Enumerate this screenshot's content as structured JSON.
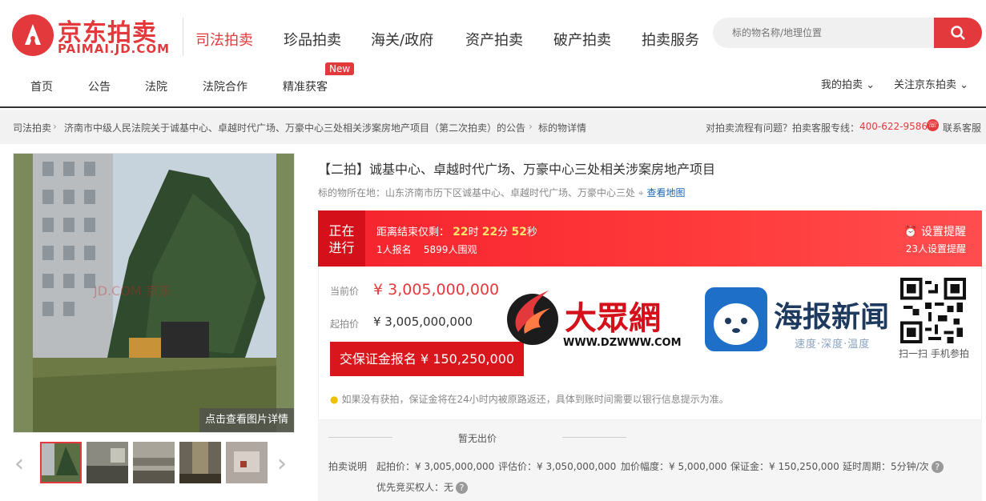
{
  "header": {
    "logo_cn": "京东拍卖",
    "logo_en": "PAIMAI.JD.COM",
    "categories": [
      "司法拍卖",
      "珍品拍卖",
      "海关/政府",
      "资产拍卖",
      "破产拍卖",
      "拍卖服务"
    ],
    "search_placeholder": "标的物名称/地理位置",
    "nav": [
      "首页",
      "公告",
      "法院",
      "法院合作",
      "精准获客"
    ],
    "new_tag": "New",
    "right_nav": [
      "我的拍卖",
      "关注京东拍卖"
    ],
    "accent_color": "#e4393c"
  },
  "breadcrumb": {
    "items": [
      "司法拍卖",
      "济南市中级人民法院关于诚基中心、卓越时代广场、万豪中心三处相关涉案房地产项目（第二次拍卖）的公告",
      "标的物详情"
    ],
    "help_text": "对拍卖流程有问题？拍卖客服专线：",
    "phone": "400-622-9586",
    "service": "联系客服"
  },
  "gallery": {
    "image_button": "点击查看图片详情",
    "watermark": "JD.COM 京东"
  },
  "item": {
    "title": "【二拍】诚基中心、卓越时代广场、万豪中心三处相关涉案房地产项目",
    "location_label": "标的物所在地：",
    "location": "山东济南市历下区诚基中心、卓越时代广场、万豪中心三处",
    "map_link": "查看地图"
  },
  "banner": {
    "status_line1": "正在",
    "status_line2": "进行",
    "countdown_label": "距离结束仅剩：",
    "hours": "22",
    "hours_unit": "时",
    "minutes": "22",
    "minutes_unit": "分",
    "seconds": "52",
    "seconds_unit": "秒",
    "signup": "1人报名",
    "watchers": "5899人围观",
    "reminder": "设置提醒",
    "reminder_count": "23人设置提醒"
  },
  "price": {
    "current_label": "当前价",
    "current": "¥ 3,005,000,000",
    "start_label": "起拍价",
    "start": "¥ 3,005,000,000",
    "deposit_button": "交保证金报名 ¥ 150,250,000",
    "tip": "如果没有获拍，保证金将在24小时内被原路返还，具体到账时间需要以银行信息提示为准。"
  },
  "overlay": {
    "dzw_name": "大眾網",
    "dzw_url": "WWW.DZWWW.COM",
    "hb_name": "海报新闻",
    "hb_tagline": "速度·深度·温度",
    "qr_caption": "扫一扫 手机参拍"
  },
  "bid": {
    "no_bid": "暂无出价",
    "label": "拍卖说明",
    "start_price": "起拍价：¥ 3,005,000,000",
    "appraisal": "评估价：¥ 3,050,000,000",
    "increment": "加价幅度：¥ 5,000,000",
    "deposit": "保证金：¥ 150,250,000",
    "delay": "延时周期：5分钟/次",
    "priority": "优先竞买权人：无"
  }
}
